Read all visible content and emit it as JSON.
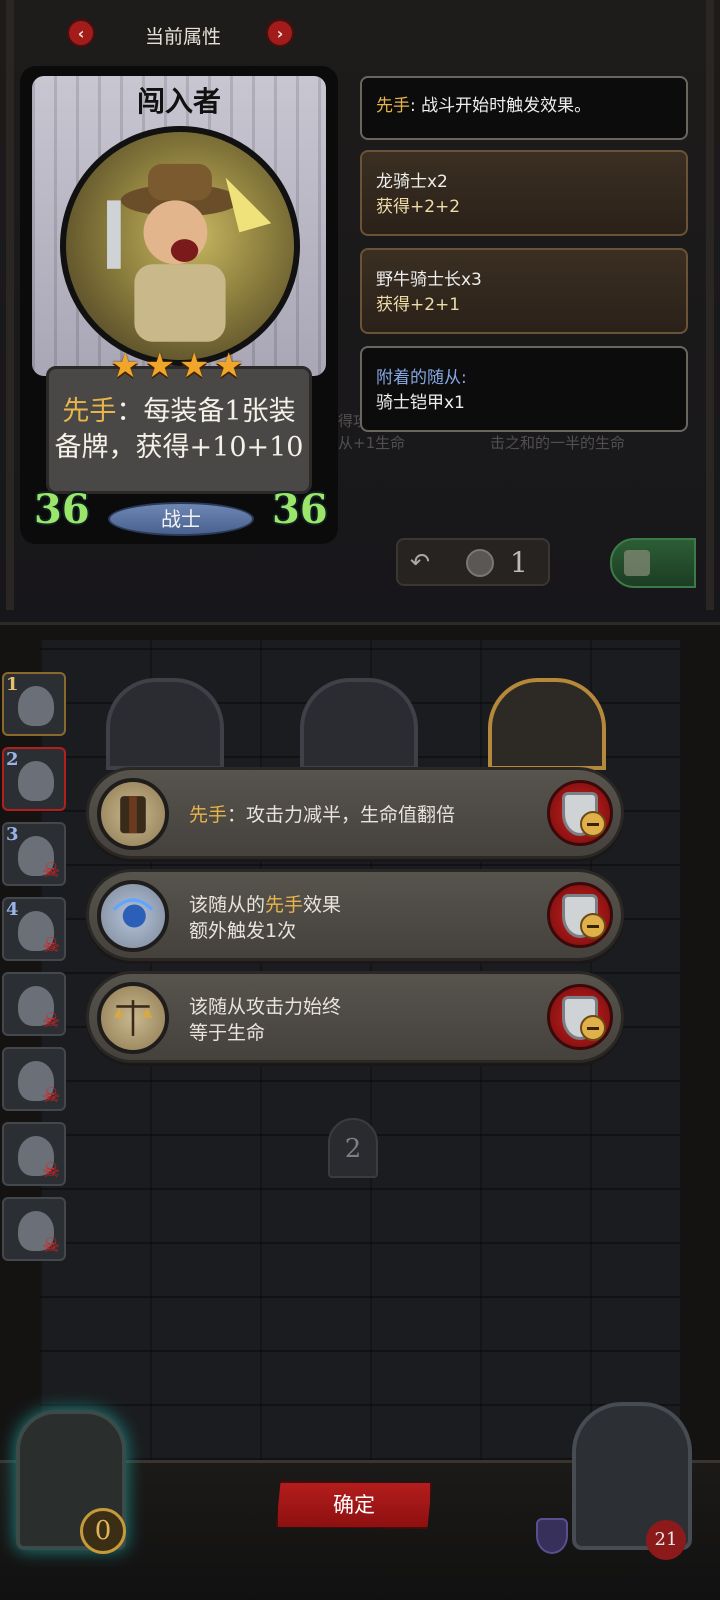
{
  "header": {
    "title": "当前属性",
    "prev_icon": "chevron-left-icon",
    "next_icon": "chevron-right-icon"
  },
  "card": {
    "name": "闯入者",
    "stars": "★★★★",
    "desc_keyword": "先手",
    "desc_line1_rest": "：每装备1张装",
    "desc_line2": "备牌，获得+10+10",
    "attack": "36",
    "health": "36",
    "class": "战士"
  },
  "effects": [
    {
      "keyword": "先手",
      "text": ": 战斗开始时触发效果。"
    },
    {
      "line1": "龙骑士x2",
      "line2": "获得+2+2"
    },
    {
      "line1": "野牛骑士长x3",
      "line2": "获得+2+1"
    },
    {
      "title": "附着的随从:",
      "line2": "骑士铠甲x1"
    }
  ],
  "util": {
    "undo_icon": "undo-icon",
    "count": "1"
  },
  "roster": [
    {
      "num": "1",
      "dead": false
    },
    {
      "num": "2",
      "dead": false
    },
    {
      "num": "3",
      "dead": true
    },
    {
      "num": "4",
      "dead": true
    },
    {
      "num": "",
      "dead": true
    },
    {
      "num": "",
      "dead": true
    },
    {
      "num": "",
      "dead": true
    },
    {
      "num": "",
      "dead": true
    }
  ],
  "options": [
    {
      "keyword": "先手",
      "rest": "：攻击力减半，生命值翻倍",
      "line2": ""
    },
    {
      "pre": "该随从的",
      "keyword": "先手",
      "rest": "效果",
      "line2": "额外触发1次"
    },
    {
      "pre": "该随从攻击力始终",
      "keyword": "",
      "rest": "",
      "line2": "等于生命"
    }
  ],
  "page_indicator": "2",
  "confirm_label": "确定",
  "shop_coins": "0",
  "hero_hp": "21",
  "colors": {
    "keyword": "#e8b54a",
    "stat_green": "#9be56a",
    "accent_red": "#b41d1d"
  }
}
